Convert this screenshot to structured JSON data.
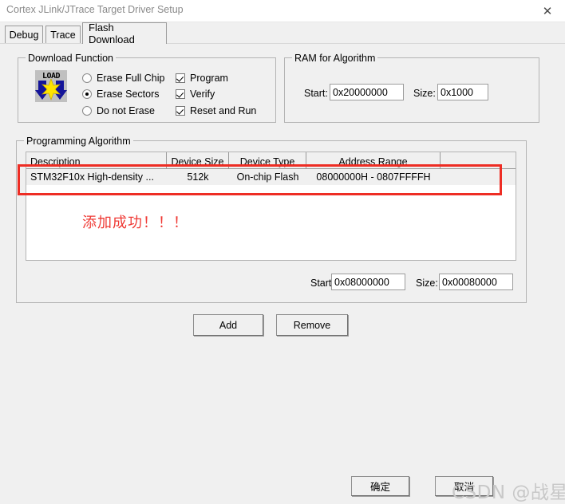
{
  "window": {
    "title": "Cortex JLink/JTrace Target Driver Setup",
    "close_icon": "close-icon"
  },
  "tabs": [
    {
      "label": "Debug",
      "active": false
    },
    {
      "label": "Trace",
      "active": false
    },
    {
      "label": "Flash Download",
      "active": true
    }
  ],
  "download_function": {
    "title": "Download Function",
    "icon": "load-icon",
    "icon_label": "LOAD",
    "radios": [
      {
        "label": "Erase Full Chip",
        "selected": false
      },
      {
        "label": "Erase Sectors",
        "selected": true
      },
      {
        "label": "Do not Erase",
        "selected": false
      }
    ],
    "checkboxes": [
      {
        "label": "Program",
        "checked": true
      },
      {
        "label": "Verify",
        "checked": true
      },
      {
        "label": "Reset and Run",
        "checked": true
      }
    ]
  },
  "ram_for_algorithm": {
    "title": "RAM for Algorithm",
    "start_label": "Start:",
    "start_value": "0x20000000",
    "size_label": "Size:",
    "size_value": "0x1000"
  },
  "programming_algorithm": {
    "title": "Programming Algorithm",
    "columns": [
      "Description",
      "Device Size",
      "Device Type",
      "Address Range",
      ""
    ],
    "rows": [
      {
        "description": "STM32F10x High-density ...",
        "device_size": "512k",
        "device_type": "On-chip Flash",
        "address_range": "08000000H - 0807FFFFH",
        "extra": ""
      }
    ],
    "annotation_text": "添加成功！！！",
    "annotation_color": "#ef3b36",
    "highlight_color": "#ee2d24",
    "start_label": "Start:",
    "start_value": "0x08000000",
    "size_label": "Size:",
    "size_value": "0x00080000",
    "add_button": "Add",
    "remove_button": "Remove"
  },
  "footer": {
    "ok_button": "确定",
    "cancel_button": "取消",
    "watermark": "CSDN @战星野"
  }
}
